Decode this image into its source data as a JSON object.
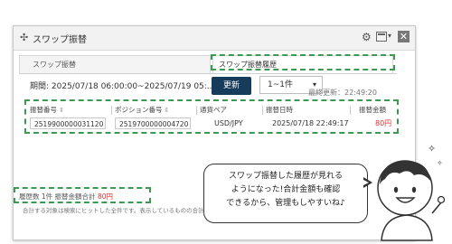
{
  "window": {
    "title": "スワップ振替",
    "move_icon": "✣",
    "gear_icon": "⚙",
    "caret_icon": "▾",
    "close_icon": "✕"
  },
  "tabs": [
    {
      "label": "スワップ振替"
    },
    {
      "label": "スワップ振替履歴"
    }
  ],
  "toolbar": {
    "period_label": "期間: 2025/07/18 06:00:00~2025/07/19 05:...",
    "update_button": "更新",
    "range_select": "1~1件",
    "range_caret": "▾",
    "last_updated": "最終更新：22:49:20"
  },
  "table": {
    "headers": [
      "振替番号",
      "ポジション番号",
      "通貨ペア",
      "振替日時",
      "振替金額"
    ],
    "sort_icon": "⇕",
    "row": {
      "transfer_no": "2519900000031120",
      "position_no": "2519700000004720",
      "pair": "USD/JPY",
      "datetime": "2025/07/18 22:49:17",
      "amount": "80円"
    }
  },
  "footer": {
    "summary": "履歴数 1件 振替金額合計",
    "total": "80円",
    "note": "合計する対象は検索にヒットした全件です。表示しているものの合計ではあり"
  },
  "bubble": {
    "lines": [
      "スワップ振替した履歴が見れる",
      "ようになった!合計金額も確認",
      "できるから、管理もしやすいね♪"
    ]
  },
  "colors": {
    "accent_green": "#3a9a52",
    "button_navy": "#173b5a",
    "amount_red": "#e0302f"
  }
}
